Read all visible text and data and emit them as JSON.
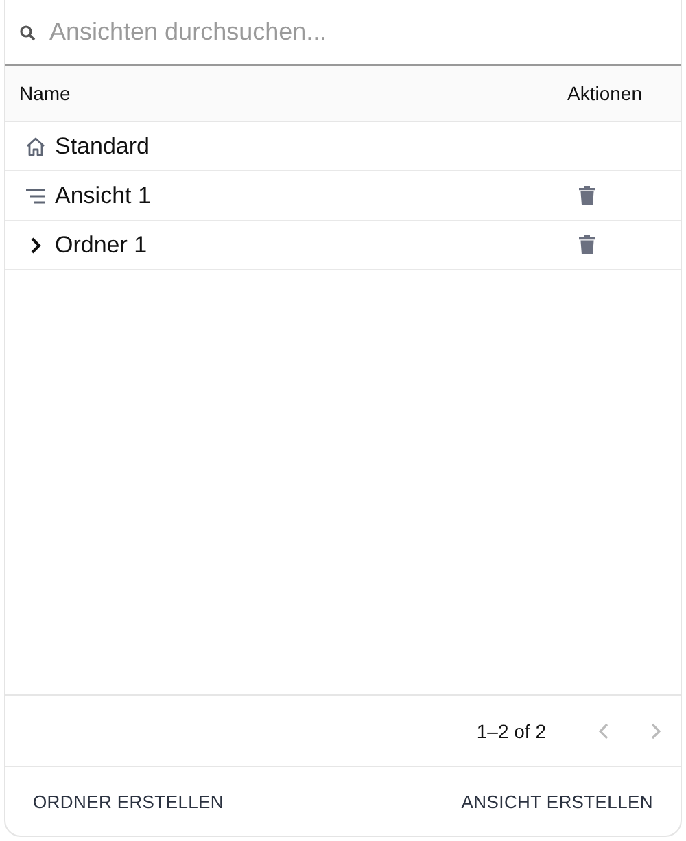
{
  "search": {
    "placeholder": "Ansichten durchsuchen..."
  },
  "table": {
    "columns": [
      "Name",
      "Aktionen"
    ],
    "rows": [
      {
        "kind": "home",
        "name": "Standard",
        "deletable": false
      },
      {
        "kind": "view",
        "name": "Ansicht 1",
        "deletable": true
      },
      {
        "kind": "folder",
        "name": "Ordner 1",
        "deletable": true
      }
    ]
  },
  "pagination": {
    "range": "1–2 of 2",
    "prev_disabled": true,
    "next_disabled": true
  },
  "buttons": [
    "ORDNER ERSTELLEN",
    "ANSICHT ERSTELLEN"
  ]
}
